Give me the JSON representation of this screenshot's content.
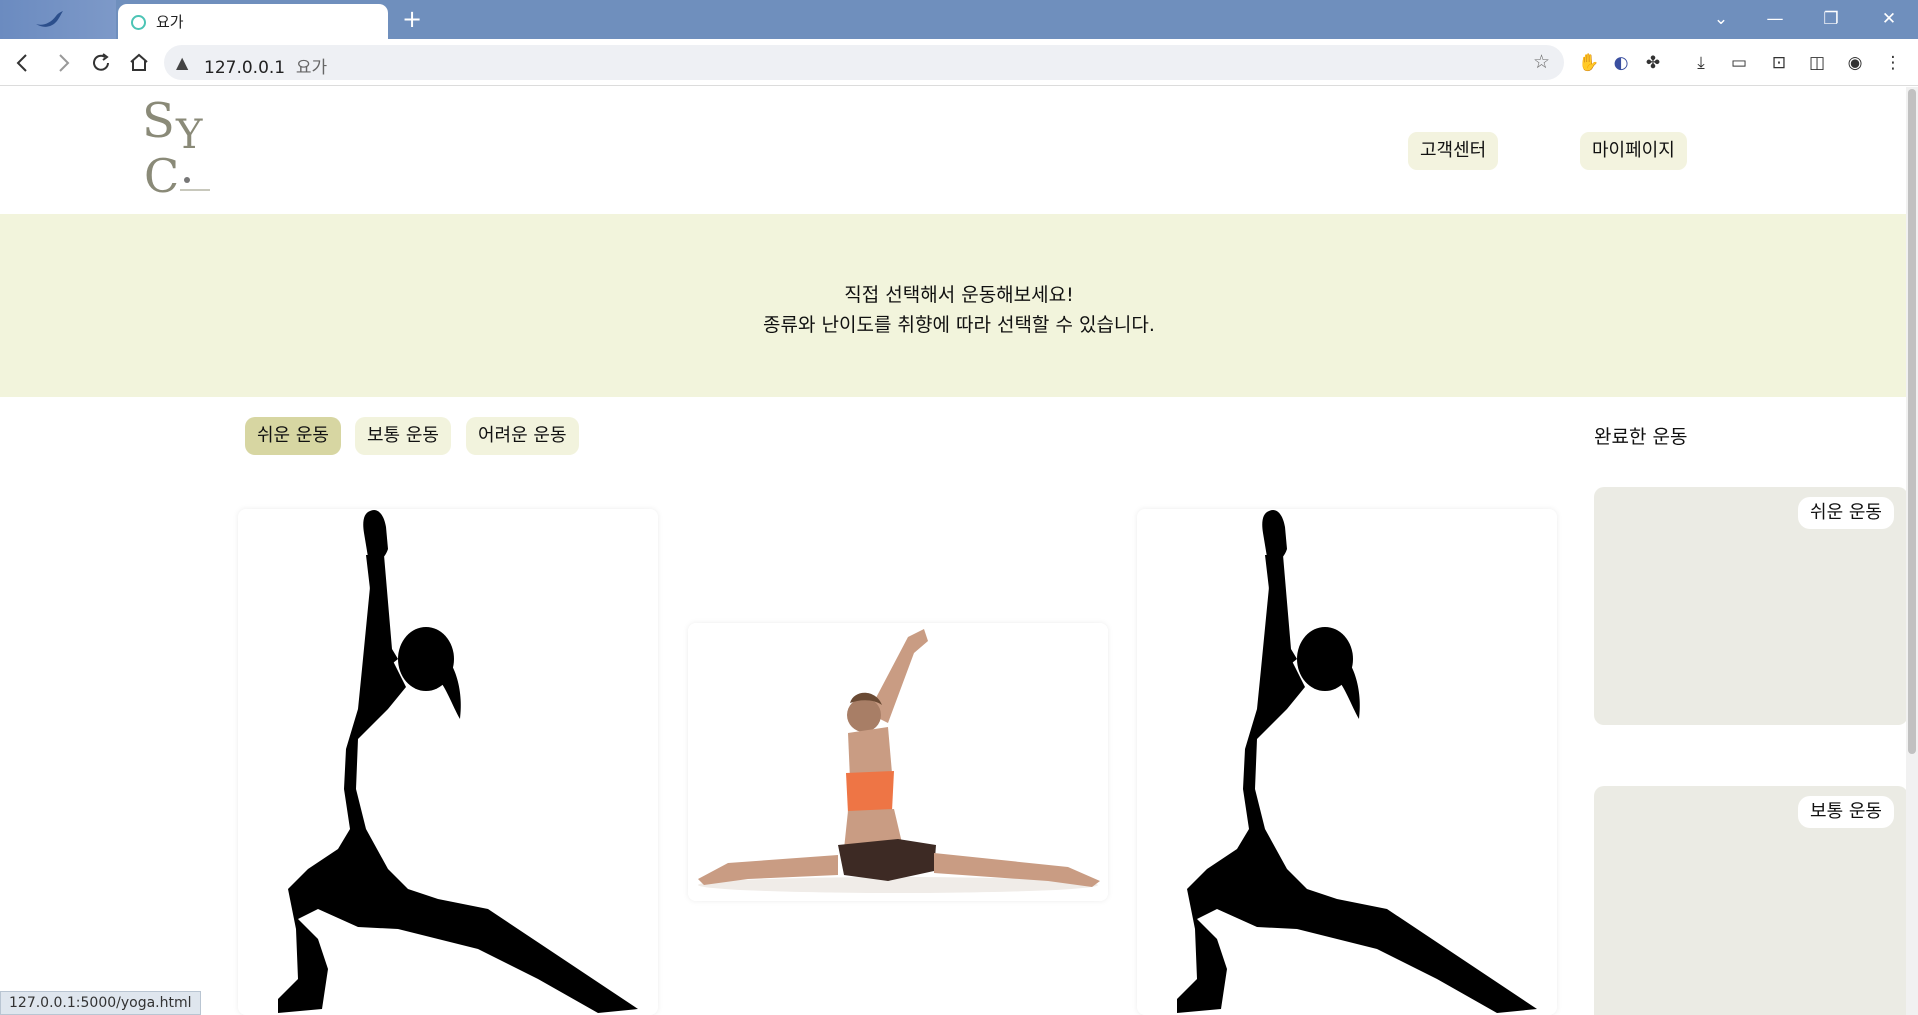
{
  "browser": {
    "tab_title": "요가",
    "new_tab": "+",
    "url_host": "127.0.0.1",
    "url_title": "요가",
    "status_url": "127.0.0.1:5000/yoga.html",
    "win_minimize": "—",
    "win_restore": "❐",
    "win_close": "✕",
    "win_dropdown": "⌄"
  },
  "header": {
    "logo_s": "S",
    "logo_y": "Y",
    "logo_c": "C",
    "customer_center": "고객센터",
    "mypage": "마이페이지"
  },
  "banner": {
    "line1": "직접 선택해서 운동해보세요!",
    "line2": "종류와 난이도를 취향에 따라 선택할 수 있습니다."
  },
  "filters": {
    "easy": "쉬운 운동",
    "normal": "보통 운동",
    "hard": "어려운 운동"
  },
  "completed": {
    "title": "완료한 운동",
    "easy_badge": "쉬운 운동",
    "normal_badge": "보통 운동"
  }
}
